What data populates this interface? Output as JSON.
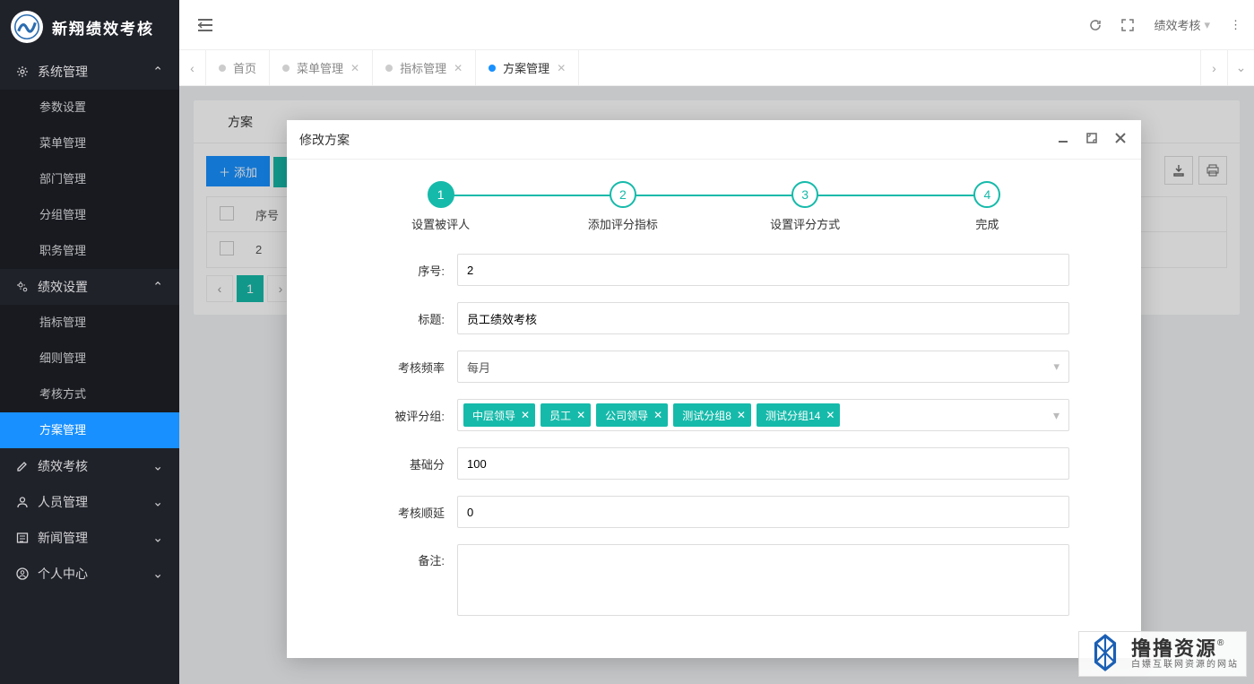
{
  "brand": {
    "title": "新翔绩效考核"
  },
  "header": {
    "user_menu": "绩效考核"
  },
  "tabs": [
    {
      "label": "首页",
      "active": false,
      "closable": false
    },
    {
      "label": "菜单管理",
      "active": false,
      "closable": true
    },
    {
      "label": "指标管理",
      "active": false,
      "closable": true
    },
    {
      "label": "方案管理",
      "active": true,
      "closable": true
    }
  ],
  "sidebar": [
    {
      "label": "系统管理",
      "icon": "gear",
      "open": true,
      "items": [
        {
          "label": "参数设置"
        },
        {
          "label": "菜单管理"
        },
        {
          "label": "部门管理"
        },
        {
          "label": "分组管理"
        },
        {
          "label": "职务管理"
        }
      ]
    },
    {
      "label": "绩效设置",
      "icon": "gears",
      "open": true,
      "items": [
        {
          "label": "指标管理"
        },
        {
          "label": "细则管理"
        },
        {
          "label": "考核方式"
        },
        {
          "label": "方案管理",
          "active": true
        }
      ]
    },
    {
      "label": "绩效考核",
      "icon": "edit",
      "open": false
    },
    {
      "label": "人员管理",
      "icon": "user",
      "open": false
    },
    {
      "label": "新闻管理",
      "icon": "news",
      "open": false
    },
    {
      "label": "个人中心",
      "icon": "usercircle",
      "open": false
    }
  ],
  "panel": {
    "tab_label": "方案",
    "btn_add": "添加",
    "col_seq": "序号",
    "row_seq": "2",
    "page_current": "1"
  },
  "modal": {
    "title": "修改方案",
    "steps": [
      {
        "num": "1",
        "label": "设置被评人",
        "active": true
      },
      {
        "num": "2",
        "label": "添加评分指标"
      },
      {
        "num": "3",
        "label": "设置评分方式"
      },
      {
        "num": "4",
        "label": "完成"
      }
    ],
    "form": {
      "seq_label": "序号:",
      "seq_value": "2",
      "title_label": "标题:",
      "title_value": "员工绩效考核",
      "freq_label": "考核频率",
      "freq_value": "每月",
      "group_label": "被评分组:",
      "tags": [
        "中层领导",
        "员工",
        "公司领导",
        "测试分组8",
        "测试分组14"
      ],
      "base_label": "基础分",
      "base_value": "100",
      "delay_label": "考核顺延",
      "delay_value": "0",
      "remark_label": "备注:",
      "remark_value": ""
    }
  },
  "watermark": {
    "big": "撸撸资源",
    "small": "白嫖互联网资源的网站"
  }
}
